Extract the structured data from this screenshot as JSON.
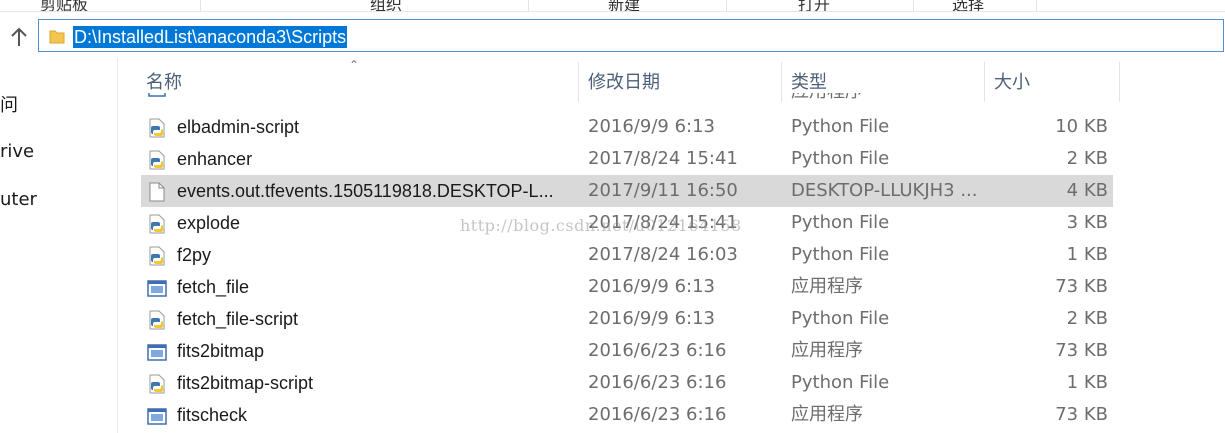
{
  "ribbon": {
    "labels": [
      "剪贴板",
      "组织",
      "新建",
      "打开",
      "选择"
    ]
  },
  "address_bar": {
    "path": "D:\\InstalledList\\anaconda3\\Scripts"
  },
  "nav_pane": {
    "items": [
      "问",
      "rive",
      "uter"
    ]
  },
  "columns": {
    "name": "名称",
    "date": "修改日期",
    "type": "类型",
    "size": "大小"
  },
  "partial_row": {
    "type": "应用程序"
  },
  "files": [
    {
      "name": "elbadmin-script",
      "date": "2016/9/9 6:13",
      "type": "Python File",
      "size": "10 KB",
      "icon": "python-file-icon"
    },
    {
      "name": "enhancer",
      "date": "2017/8/24 15:41",
      "type": "Python File",
      "size": "2 KB",
      "icon": "python-file-icon"
    },
    {
      "name": "events.out.tfevents.1505119818.DESKTOP-L...",
      "date": "2017/9/11 16:50",
      "type": "DESKTOP-LLUKJH3 ...",
      "size": "4 KB",
      "icon": "blank-file-icon",
      "selected": true
    },
    {
      "name": "explode",
      "date": "2017/8/24 15:41",
      "type": "Python File",
      "size": "3 KB",
      "icon": "python-file-icon"
    },
    {
      "name": "f2py",
      "date": "2017/8/24 16:03",
      "type": "Python File",
      "size": "1 KB",
      "icon": "python-file-icon"
    },
    {
      "name": "fetch_file",
      "date": "2016/9/9 6:13",
      "type": "应用程序",
      "size": "73 KB",
      "icon": "application-icon"
    },
    {
      "name": "fetch_file-script",
      "date": "2016/9/9 6:13",
      "type": "Python File",
      "size": "2 KB",
      "icon": "python-file-icon"
    },
    {
      "name": "fits2bitmap",
      "date": "2016/6/23 6:16",
      "type": "应用程序",
      "size": "73 KB",
      "icon": "application-icon"
    },
    {
      "name": "fits2bitmap-script",
      "date": "2016/6/23 6:16",
      "type": "Python File",
      "size": "1 KB",
      "icon": "python-file-icon"
    },
    {
      "name": "fitscheck",
      "date": "2016/6/23 6:16",
      "type": "应用程序",
      "size": "73 KB",
      "icon": "application-icon"
    }
  ],
  "watermark": "http://blog.csdn.net/u012164158",
  "colors": {
    "selection_highlight": "#0078d7",
    "selected_row": "#d9d9d9",
    "header_text": "#4c607a"
  }
}
